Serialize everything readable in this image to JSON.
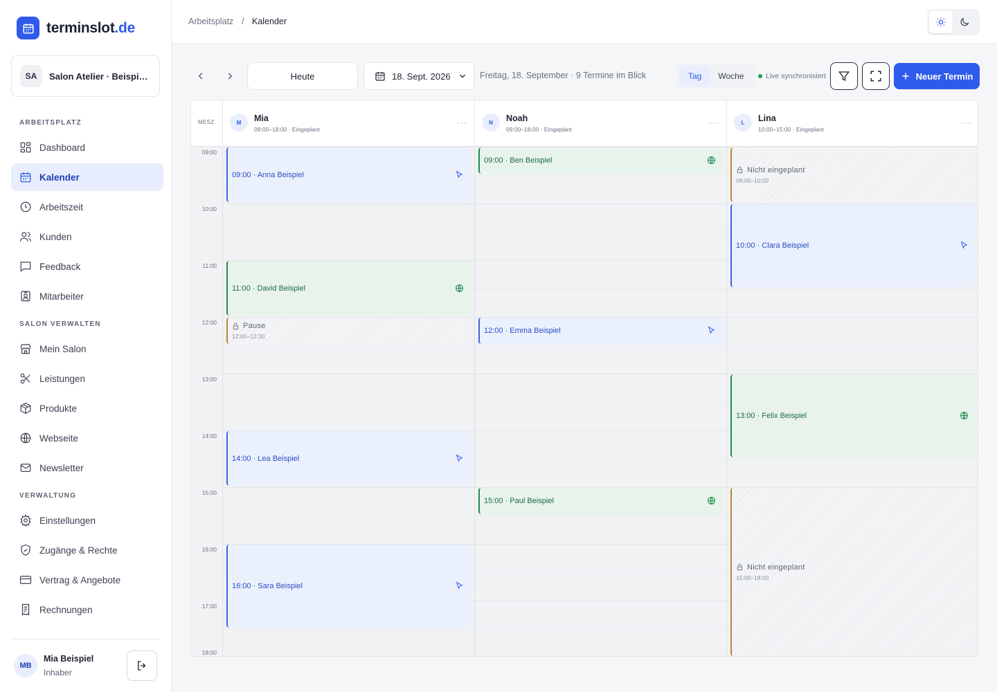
{
  "brand": {
    "name": "terminslot",
    "tld": ".de"
  },
  "salon": {
    "initials": "SA",
    "name": "Salon Atelier · Beispiel..."
  },
  "sidebar": {
    "sections": [
      {
        "title": "ARBEITSPLATZ"
      },
      {
        "title": "SALON VERWALTEN"
      },
      {
        "title": "VERWALTUNG"
      }
    ],
    "items": [
      {
        "label": "Dashboard",
        "icon": "dashboard-icon"
      },
      {
        "label": "Kalender",
        "icon": "calendar-icon",
        "active": true
      },
      {
        "label": "Arbeitszeit",
        "icon": "clock-icon"
      },
      {
        "label": "Kunden",
        "icon": "users-icon"
      },
      {
        "label": "Feedback",
        "icon": "message-icon"
      },
      {
        "label": "Mitarbeiter",
        "icon": "badge-icon"
      },
      {
        "label": "Mein Salon",
        "icon": "store-icon"
      },
      {
        "label": "Leistungen",
        "icon": "scissors-icon"
      },
      {
        "label": "Produkte",
        "icon": "package-icon"
      },
      {
        "label": "Webseite",
        "icon": "globe-icon"
      },
      {
        "label": "Newsletter",
        "icon": "mail-icon"
      },
      {
        "label": "Einstellungen",
        "icon": "gear-icon"
      },
      {
        "label": "Zugänge & Rechte",
        "icon": "shield-icon"
      },
      {
        "label": "Vertrag & Angebote",
        "icon": "card-icon"
      },
      {
        "label": "Rechnungen",
        "icon": "receipt-icon"
      }
    ]
  },
  "user": {
    "initials": "MB",
    "name": "Mia Beispiel",
    "role": "Inhaber"
  },
  "breadcrumb": {
    "root": "Arbeitsplatz",
    "separator": "/",
    "current": "Kalender"
  },
  "toolbar": {
    "today_label": "Heute",
    "date_label": "18. Sept. 2026",
    "summary": "Freitag, 18. September · 9 Termine im Blick",
    "view_day": "Tag",
    "view_week": "Woche",
    "live_label": "Live synchronisiert",
    "new_label": "Neuer Termin"
  },
  "calendar": {
    "timezone": "MESZ",
    "hours": [
      "09:00",
      "10:00",
      "11:00",
      "12:00",
      "13:00",
      "14:00",
      "15:00",
      "16:00",
      "17:00",
      "18:00"
    ],
    "staff": [
      {
        "initial": "M",
        "name": "Mia",
        "hours": "09:00–18:00 · Eingeplant"
      },
      {
        "initial": "N",
        "name": "Noah",
        "hours": "09:00–18:00 · Eingeplant"
      },
      {
        "initial": "L",
        "name": "Lina",
        "hours": "10:00–15:00 · Eingeplant"
      }
    ],
    "events": [
      {
        "col": 0,
        "start": 9.0,
        "end": 10.0,
        "type": "blue",
        "label": "09:00 · Anna Beispiel",
        "icon": "cursor-icon"
      },
      {
        "col": 0,
        "start": 11.0,
        "end": 12.0,
        "type": "green",
        "label": "11:00 · David Beispiel",
        "icon": "globe-icon"
      },
      {
        "col": 0,
        "start": 12.0,
        "end": 12.5,
        "type": "block",
        "label": "Pause",
        "time": "12:00–12:30"
      },
      {
        "col": 0,
        "start": 14.0,
        "end": 15.0,
        "type": "blue",
        "label": "14:00 · Lea Beispiel",
        "icon": "cursor-icon"
      },
      {
        "col": 0,
        "start": 16.0,
        "end": 17.5,
        "type": "blue",
        "label": "16:00 · Sara Beispiel",
        "icon": "cursor-icon"
      },
      {
        "col": 1,
        "start": 9.0,
        "end": 9.5,
        "type": "green",
        "label": "09:00 · Ben Beispiel",
        "icon": "globe-icon"
      },
      {
        "col": 1,
        "start": 12.0,
        "end": 12.5,
        "type": "blue",
        "label": "12:00 · Emma Beispiel",
        "icon": "cursor-icon"
      },
      {
        "col": 1,
        "start": 15.0,
        "end": 15.5,
        "type": "green",
        "label": "15:00 · Paul Beispiel",
        "icon": "globe-icon"
      },
      {
        "col": 2,
        "start": 9.0,
        "end": 10.0,
        "type": "block",
        "label": "Nicht eingeplant",
        "time": "09:00–10:00"
      },
      {
        "col": 2,
        "start": 10.0,
        "end": 11.5,
        "type": "blue",
        "label": "10:00 · Clara Beispiel",
        "icon": "cursor-icon"
      },
      {
        "col": 2,
        "start": 13.0,
        "end": 14.5,
        "type": "green",
        "label": "13:00 · Felix Beispiel",
        "icon": "globe-icon"
      },
      {
        "col": 2,
        "start": 15.0,
        "end": 18.0,
        "type": "block",
        "label": "Nicht eingeplant",
        "time": "15:00–18:00"
      }
    ]
  }
}
